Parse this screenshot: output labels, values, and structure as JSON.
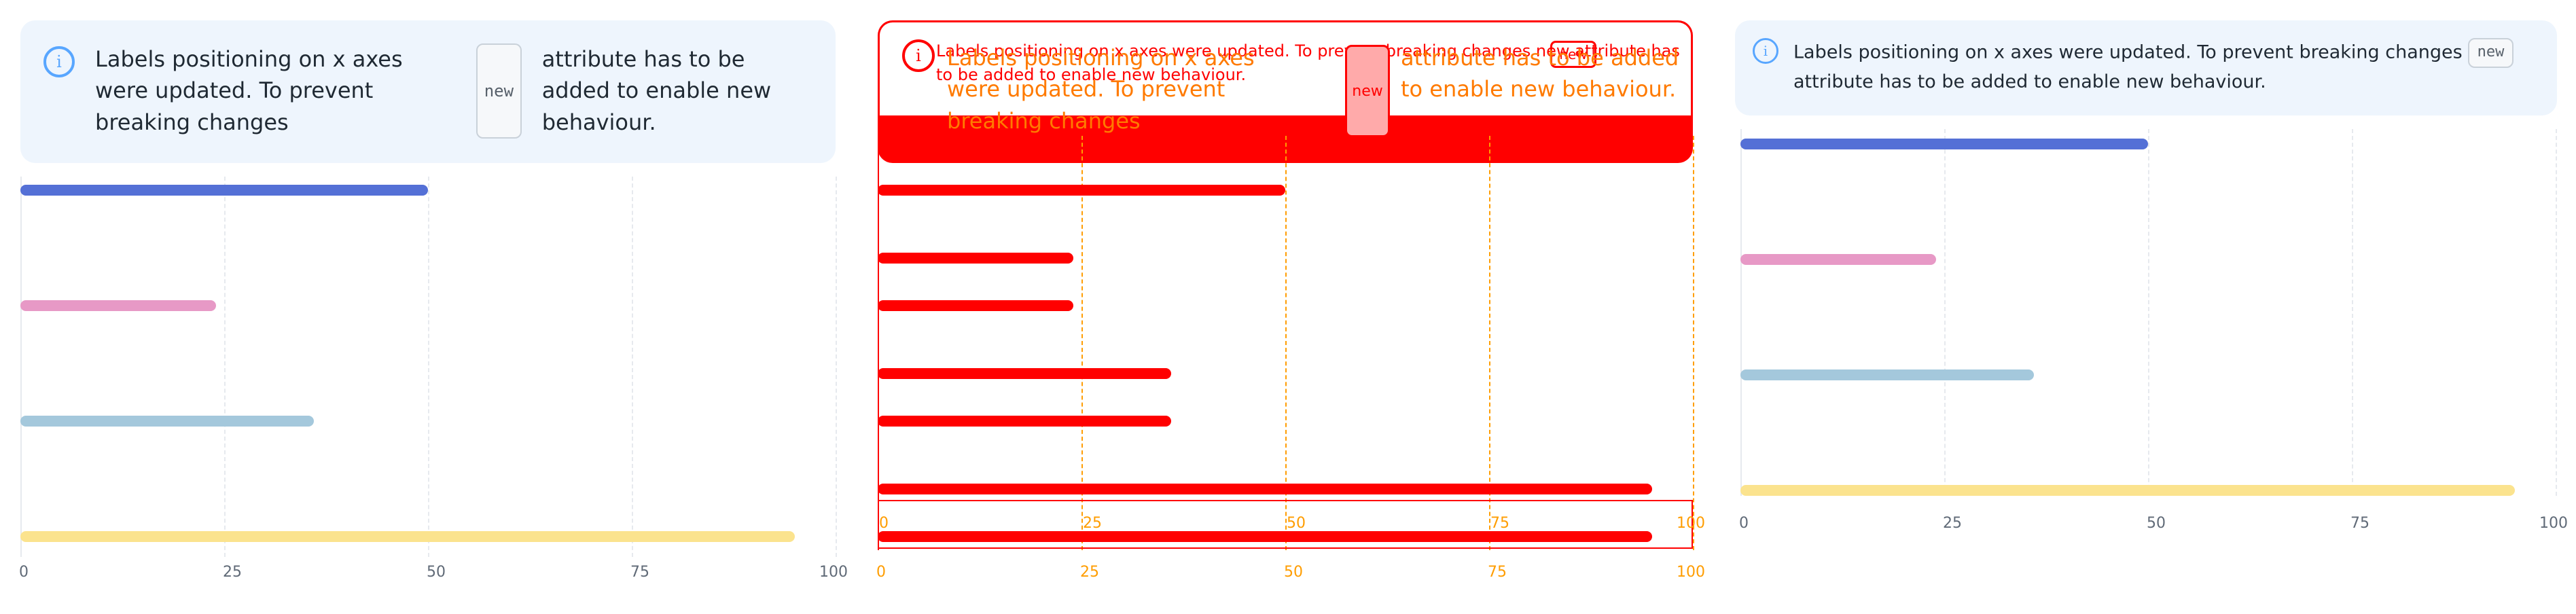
{
  "alert": {
    "text_before": "Labels positioning on x axes were updated. To prevent breaking changes",
    "badge": "new",
    "text_after": "attribute has to be added to enable new behaviour.",
    "icon": "info-icon"
  },
  "chart_data": [
    {
      "type": "bar",
      "title": "",
      "orientation": "horizontal",
      "categories": [
        "",
        "",
        "",
        ""
      ],
      "values": [
        50,
        24,
        36,
        95
      ],
      "series_colors": [
        "#5470d6",
        "#e799c6",
        "#a4c8dc",
        "#fbe38e"
      ],
      "x_ticks": [
        "0",
        "25",
        "50",
        "75",
        "100"
      ],
      "xlim": [
        0,
        100
      ],
      "grid": true
    },
    {
      "type": "bar",
      "title": "",
      "orientation": "horizontal",
      "categories": [
        "",
        "",
        "",
        ""
      ],
      "values": [
        50,
        24,
        36,
        95
      ],
      "series_colors": [
        "#ff0000",
        "#ff0000",
        "#ff0000",
        "#ff0000"
      ],
      "x_ticks": [
        "0",
        "25",
        "50",
        "75",
        "100"
      ],
      "xlim": [
        0,
        100
      ],
      "grid": true
    },
    {
      "type": "bar",
      "title": "",
      "orientation": "horizontal",
      "categories": [
        "",
        "",
        "",
        ""
      ],
      "values": [
        50,
        24,
        36,
        95
      ],
      "series_colors": [
        "#5470d6",
        "#e799c6",
        "#a4c8dc",
        "#fbe38e"
      ],
      "x_ticks": [
        "0",
        "25",
        "50",
        "75",
        "100"
      ],
      "xlim": [
        0,
        100
      ],
      "grid": true
    }
  ]
}
